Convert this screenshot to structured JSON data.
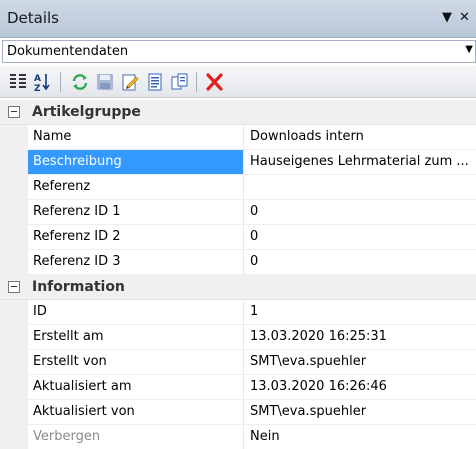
{
  "panel": {
    "title": "Details"
  },
  "window_controls": {
    "dropdown_glyph": "▼",
    "close_glyph": "✕"
  },
  "object_selector": {
    "value": "Dokumentendaten",
    "arrow": "▼"
  },
  "toolbar": {
    "buttons": [
      {
        "icon": "categorized-view-icon"
      },
      {
        "icon": "sort-alphabetical-icon"
      },
      {
        "icon": "refresh-icon"
      },
      {
        "icon": "save-icon"
      },
      {
        "icon": "edit-icon"
      },
      {
        "icon": "document-icon"
      },
      {
        "icon": "copy-icon"
      },
      {
        "icon": "delete-icon"
      }
    ],
    "accent_delete": "#e02020",
    "accent_refresh": "#2fa84f"
  },
  "categories": [
    {
      "label": "Artikelgruppe",
      "rows": [
        {
          "name": "Name",
          "value": "Downloads intern"
        },
        {
          "name": "Beschreibung",
          "value": "Hauseigenes Lehrmaterial zum ...",
          "selected": true
        },
        {
          "name": "Referenz",
          "value": ""
        },
        {
          "name": "Referenz ID 1",
          "value": "0"
        },
        {
          "name": "Referenz ID 2",
          "value": "0"
        },
        {
          "name": "Referenz ID 3",
          "value": "0"
        }
      ]
    },
    {
      "label": "Information",
      "rows": [
        {
          "name": "ID",
          "value": "1"
        },
        {
          "name": "Erstellt am",
          "value": "13.03.2020 16:25:31"
        },
        {
          "name": "Erstellt von",
          "value": "SMT\\eva.spuehler"
        },
        {
          "name": "Aktualisiert am",
          "value": "13.03.2020 16:26:46"
        },
        {
          "name": "Aktualisiert von",
          "value": "SMT\\eva.spuehler"
        },
        {
          "name": "Verbergen",
          "value": "Nein",
          "disabled": true
        }
      ]
    }
  ],
  "colors": {
    "selection": "#3399ff",
    "titlebar": "#c4d0df"
  }
}
